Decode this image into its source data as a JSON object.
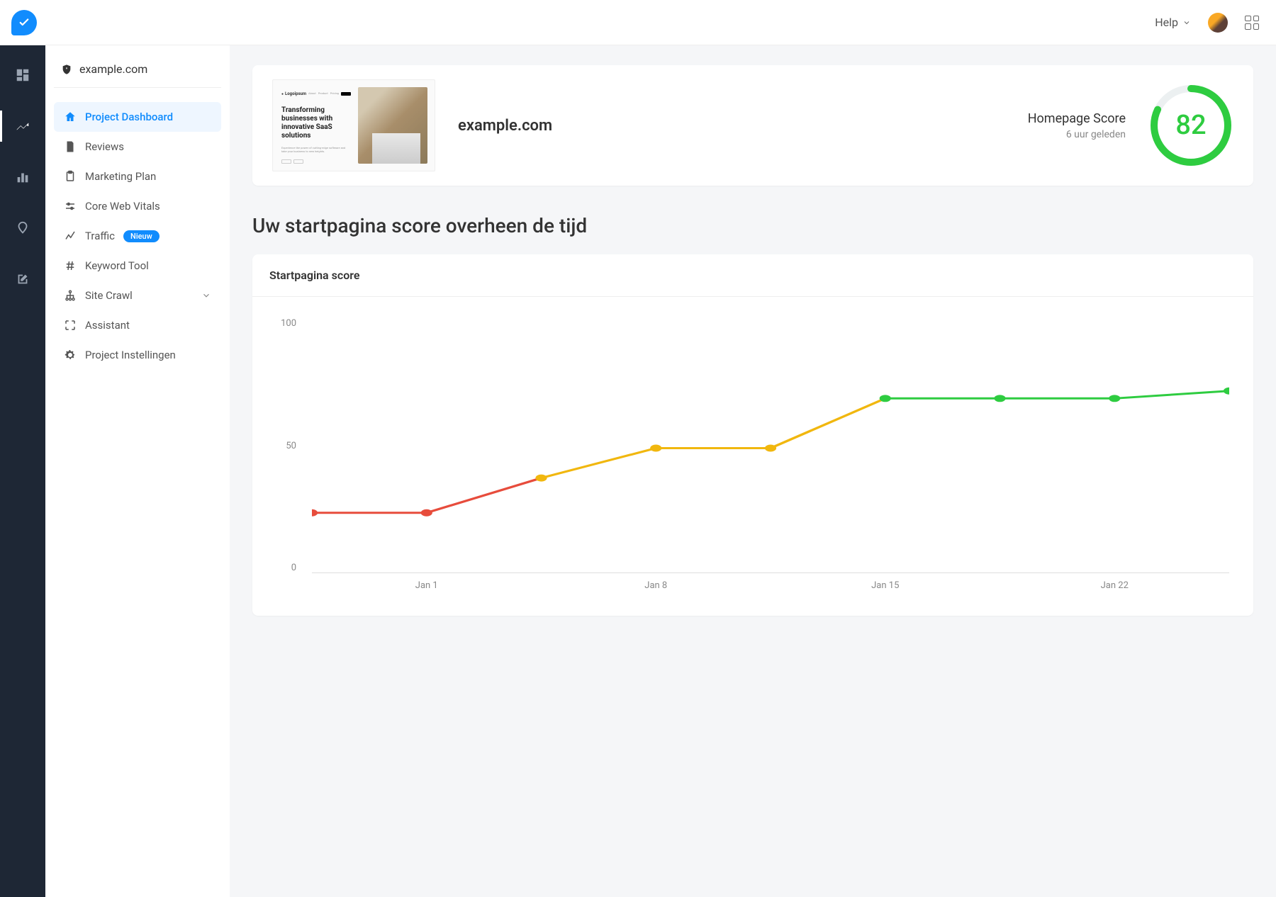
{
  "topbar": {
    "help_label": "Help"
  },
  "site": {
    "domain": "example.com"
  },
  "sidebar": {
    "items": [
      {
        "icon": "home",
        "label": "Project Dashboard",
        "active": true
      },
      {
        "icon": "doc",
        "label": "Reviews"
      },
      {
        "icon": "clipboard",
        "label": "Marketing Plan"
      },
      {
        "icon": "sliders",
        "label": "Core Web Vitals"
      },
      {
        "icon": "traffic",
        "label": "Traffic",
        "badge": "Nieuw"
      },
      {
        "icon": "hash",
        "label": "Keyword Tool"
      },
      {
        "icon": "sitemap",
        "label": "Site Crawl",
        "expandable": true
      },
      {
        "icon": "expand",
        "label": "Assistant"
      },
      {
        "icon": "gear",
        "label": "Project Instellingen"
      }
    ]
  },
  "score_card": {
    "domain": "example.com",
    "thumb_title": "Transforming businesses with innovative SaaS solutions",
    "meta_label": "Homepage Score",
    "meta_time": "6 uur geleden",
    "score": 82,
    "ring_color": "#2ecc40",
    "ring_bg": "#ecf0f1"
  },
  "section": {
    "title": "Uw startpagina score overheen de tijd"
  },
  "chart": {
    "header": "Startpagina score"
  },
  "chart_data": {
    "type": "line",
    "title": "Startpagina score",
    "xlabel": "",
    "ylabel": "",
    "ylim": [
      0,
      100
    ],
    "yticks": [
      0,
      50,
      100
    ],
    "x_labels": [
      "Jan 1",
      "Jan 8",
      "Jan 15",
      "Jan  22"
    ],
    "points": [
      {
        "i": 0,
        "value": 24,
        "color": "#e74c3c"
      },
      {
        "i": 1,
        "value": 24,
        "color": "#e74c3c"
      },
      {
        "i": 2,
        "value": 38,
        "color": "#f1b70e"
      },
      {
        "i": 3,
        "value": 50,
        "color": "#f1b70e"
      },
      {
        "i": 4,
        "value": 50,
        "color": "#f1b70e"
      },
      {
        "i": 5,
        "value": 70,
        "color": "#2ecc40"
      },
      {
        "i": 6,
        "value": 70,
        "color": "#2ecc40"
      },
      {
        "i": 7,
        "value": 70,
        "color": "#2ecc40"
      },
      {
        "i": 8,
        "value": 73,
        "color": "#2ecc40"
      }
    ]
  }
}
